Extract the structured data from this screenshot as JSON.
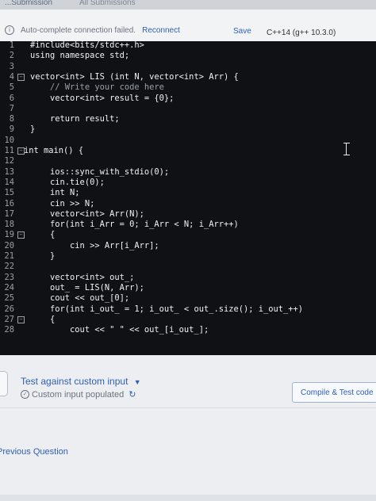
{
  "header": {
    "tab_submission": "...Submission",
    "tab_all_submissions": "All Submissions"
  },
  "toolbar": {
    "connection_status": "Auto-complete connection failed.",
    "reconnect_label": "Reconnect",
    "save_label": "Save",
    "language": "C++14 (g++ 10.3.0)"
  },
  "editor": {
    "lines": [
      {
        "num": "1",
        "text": "#include<bits/stdc++.h>",
        "fold": false
      },
      {
        "num": "2",
        "text": "using namespace std;",
        "fold": false
      },
      {
        "num": "3",
        "text": "",
        "fold": false
      },
      {
        "num": "4",
        "text": "vector<int> LIS (int N, vector<int> Arr) {",
        "fold": true
      },
      {
        "num": "5",
        "text": "    // Write your code here",
        "fold": false
      },
      {
        "num": "6",
        "text": "    vector<int> result = {0};",
        "fold": false
      },
      {
        "num": "7",
        "text": "",
        "fold": false
      },
      {
        "num": "8",
        "text": "    return result;",
        "fold": false
      },
      {
        "num": "9",
        "text": "}",
        "fold": false
      },
      {
        "num": "10",
        "text": "",
        "fold": false
      },
      {
        "num": "11",
        "text": "int main() {",
        "fold": true
      },
      {
        "num": "12",
        "text": "",
        "fold": false
      },
      {
        "num": "13",
        "text": "    ios::sync_with_stdio(0);",
        "fold": false
      },
      {
        "num": "14",
        "text": "    cin.tie(0);",
        "fold": false
      },
      {
        "num": "15",
        "text": "    int N;",
        "fold": false
      },
      {
        "num": "16",
        "text": "    cin >> N;",
        "fold": false
      },
      {
        "num": "17",
        "text": "    vector<int> Arr(N);",
        "fold": false
      },
      {
        "num": "18",
        "text": "    for(int i_Arr = 0; i_Arr < N; i_Arr++)",
        "fold": false
      },
      {
        "num": "19",
        "text": "    {",
        "fold": true
      },
      {
        "num": "20",
        "text": "        cin >> Arr[i_Arr];",
        "fold": false
      },
      {
        "num": "21",
        "text": "    }",
        "fold": false
      },
      {
        "num": "22",
        "text": "",
        "fold": false
      },
      {
        "num": "23",
        "text": "    vector<int> out_;",
        "fold": false
      },
      {
        "num": "24",
        "text": "    out_ = LIS(N, Arr);",
        "fold": false
      },
      {
        "num": "25",
        "text": "    cout << out_[0];",
        "fold": false
      },
      {
        "num": "26",
        "text": "    for(int i_out_ = 1; i_out_ < out_.size(); i_out_++)",
        "fold": false
      },
      {
        "num": "27",
        "text": "    {",
        "fold": true
      },
      {
        "num": "28",
        "text": "        cout << \" \" << out_[i_out_];",
        "fold": false
      }
    ]
  },
  "footer": {
    "test_custom_label": "Test against custom input",
    "custom_input_status": "Custom input populated",
    "compile_label": "Compile & Test code",
    "previous_question": "Previous Question"
  },
  "colors": {
    "editor_bg": "#0f1115",
    "accent": "#2f5fb3"
  }
}
